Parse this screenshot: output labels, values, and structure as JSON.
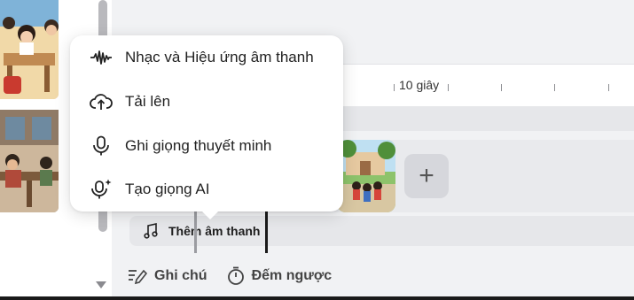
{
  "menu": {
    "items": [
      {
        "label": "Nhạc và Hiệu ứng âm thanh",
        "icon": "sound-wave-icon"
      },
      {
        "label": "Tải lên",
        "icon": "cloud-upload-icon"
      },
      {
        "label": "Ghi giọng thuyết minh",
        "icon": "microphone-icon"
      },
      {
        "label": "Tạo giọng AI",
        "icon": "ai-microphone-icon"
      }
    ]
  },
  "timeline": {
    "ruler_label": "10 giây",
    "add_label": "+",
    "audio_label": "Thêm âm thanh"
  },
  "bottom": {
    "notes_label": "Ghi chú",
    "timer_label": "Đếm ngược"
  }
}
